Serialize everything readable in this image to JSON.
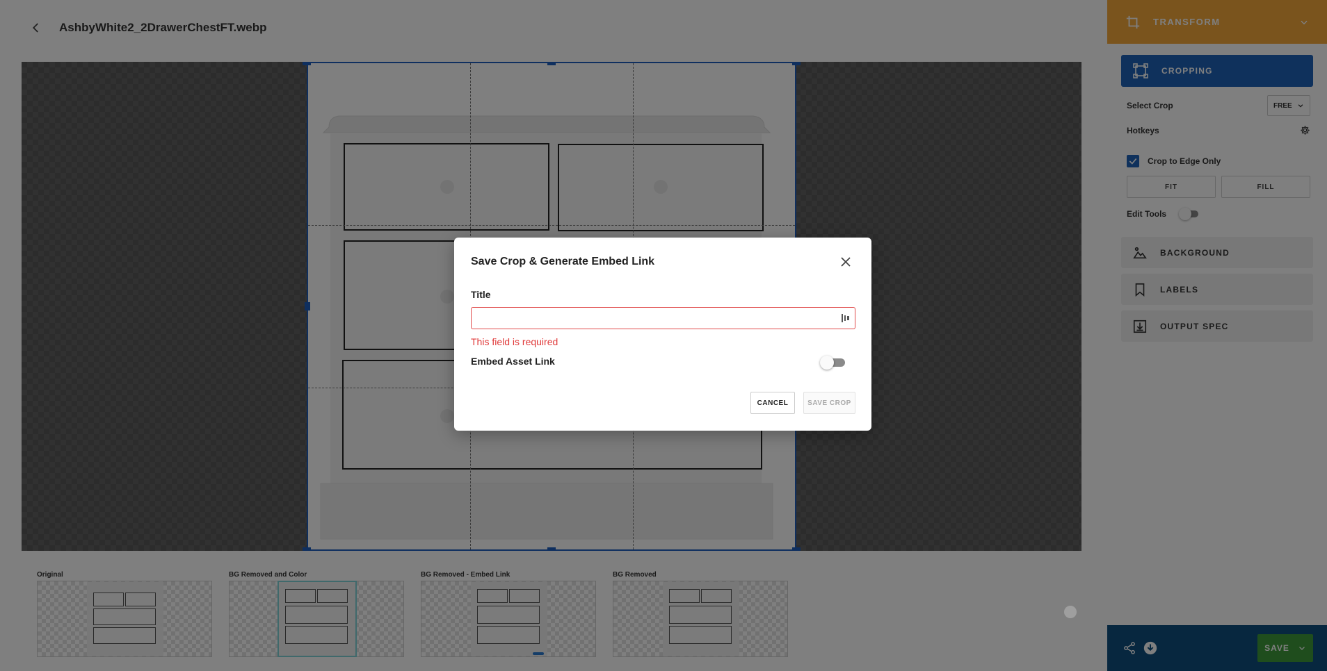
{
  "header": {
    "back_icon": "chevron-left-icon",
    "filename": "AshbyWhite2_2DrawerChestFT.webp"
  },
  "thumbnails": [
    {
      "label": "Original",
      "selected": false
    },
    {
      "label": "BG Removed and Color",
      "selected": true
    },
    {
      "label": "BG Removed - Embed Link",
      "selected": false
    },
    {
      "label": "BG Removed",
      "selected": false
    }
  ],
  "panel": {
    "transform_label": "TRANSFORM",
    "cropping_label": "CROPPING",
    "select_crop_label": "Select Crop",
    "select_crop_value": "FREE",
    "hotkeys_label": "Hotkeys",
    "crop_to_edge_label": "Crop to Edge Only",
    "crop_to_edge_checked": true,
    "fit_label": "FIT",
    "fill_label": "FILL",
    "edit_tools_label": "Edit Tools",
    "edit_tools_on": false,
    "background_label": "BACKGROUND",
    "labels_label": "LABELS",
    "output_spec_label": "OUTPUT SPEC",
    "save_label": "SAVE",
    "colors": {
      "transform": "#f4a83a",
      "cropping": "#1f62b8",
      "footer": "#0e4f7e",
      "save": "#3e9a3a"
    }
  },
  "modal": {
    "title": "Save Crop & Generate Embed Link",
    "title_field_label": "Title",
    "title_value": "",
    "error_text": "This field is required",
    "embed_label": "Embed Asset Link",
    "embed_on": false,
    "cancel_label": "CANCEL",
    "save_label": "SAVE CROP",
    "error_color": "#e03a3a"
  }
}
